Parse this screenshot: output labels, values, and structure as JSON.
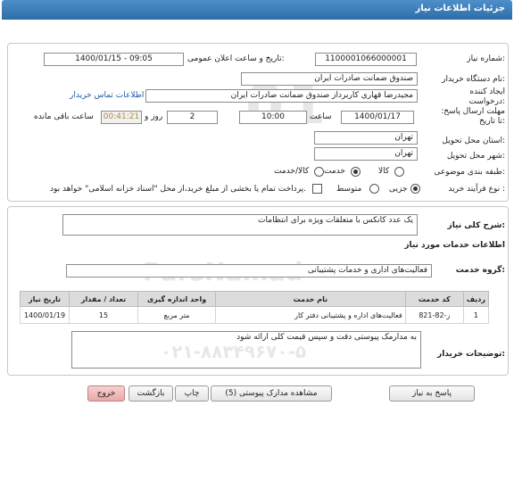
{
  "header": {
    "title": "جزئیات اطلاعات نیاز"
  },
  "watermark": {
    "brand": "ParsNamad",
    "big_number": "01",
    "phone": "۰۲۱-۸۸۳۴۹۶۷۰-۵"
  },
  "form": {
    "need_number_label": "شماره نیاز:",
    "need_number": "1100001066000001",
    "announce_label": "تاریخ و ساعت اعلان عمومی:",
    "announce_value": "1400/01/15 - 09:05",
    "buyer_name_label": "نام دستگاه خریدار:",
    "buyer_name": "صندوق ضمانت صادرات ایران",
    "creator_label": "ایجاد کننده درخواست:",
    "creator": "مجیدرضا قهاری کاربرداز صندوق ضمانت صادرات ایران",
    "buyer_contact_link": "اطلاعات تماس خریدار",
    "deadline_label": "مهلت ارسال پاسخ: تا تاریخ:",
    "deadline_date": "1400/01/17",
    "time_label": "ساعت",
    "deadline_time": "10:00",
    "days_value": "2",
    "days_label": "روز و",
    "remaining_time": "00:41:21",
    "remaining_label": "ساعت باقی مانده",
    "province_label": "استان محل تحویل:",
    "province": "تهران",
    "city_label": "شهر محل تحویل:",
    "city": "تهران",
    "category_label": "طبقه بندی موضوعی:",
    "category_options": [
      "کالا",
      "خدمت",
      "کالا/خدمت"
    ],
    "category_selected": 1,
    "process_label": "نوع فرآیند خرید :",
    "process_options": [
      "جزیی",
      "متوسط"
    ],
    "process_selected": 0,
    "payment_note": "پرداخت تمام یا بخشی از مبلغ خرید،از محل \"اسناد خزانه اسلامی\" خواهد بود."
  },
  "summary": {
    "label": "شرح کلی نیاز:",
    "value": "یک عدد کانکس با متعلقات ویژه برای انتظامات"
  },
  "services": {
    "section_title": "اطلاعات خدمات مورد نیاز",
    "group_label": "گروه خدمت:",
    "group_value": "فعالیت‌های اداری و خدمات پشتیبانی",
    "columns": [
      "ردیف",
      "کد خدمت",
      "نام خدمت",
      "واحد اندازه گیری",
      "تعداد / مقدار",
      "تاریخ نیاز"
    ],
    "rows": [
      [
        "1",
        "ز-82-821",
        "فعالیت‌های اداره و پشتیبانی دفتر کار",
        "متر مربع",
        "15",
        "1400/01/19"
      ]
    ]
  },
  "buyer_notes": {
    "label": "توضیحات خریدار:",
    "value": "به مدارمک پیوستی دقت و سپس قیمت کلی ارائه شود"
  },
  "buttons": {
    "reply": "پاسخ به نیاز",
    "attachments": "مشاهده مدارک پیوستی (5)",
    "print": "چاپ",
    "back": "بازگشت",
    "exit": "خروج"
  }
}
